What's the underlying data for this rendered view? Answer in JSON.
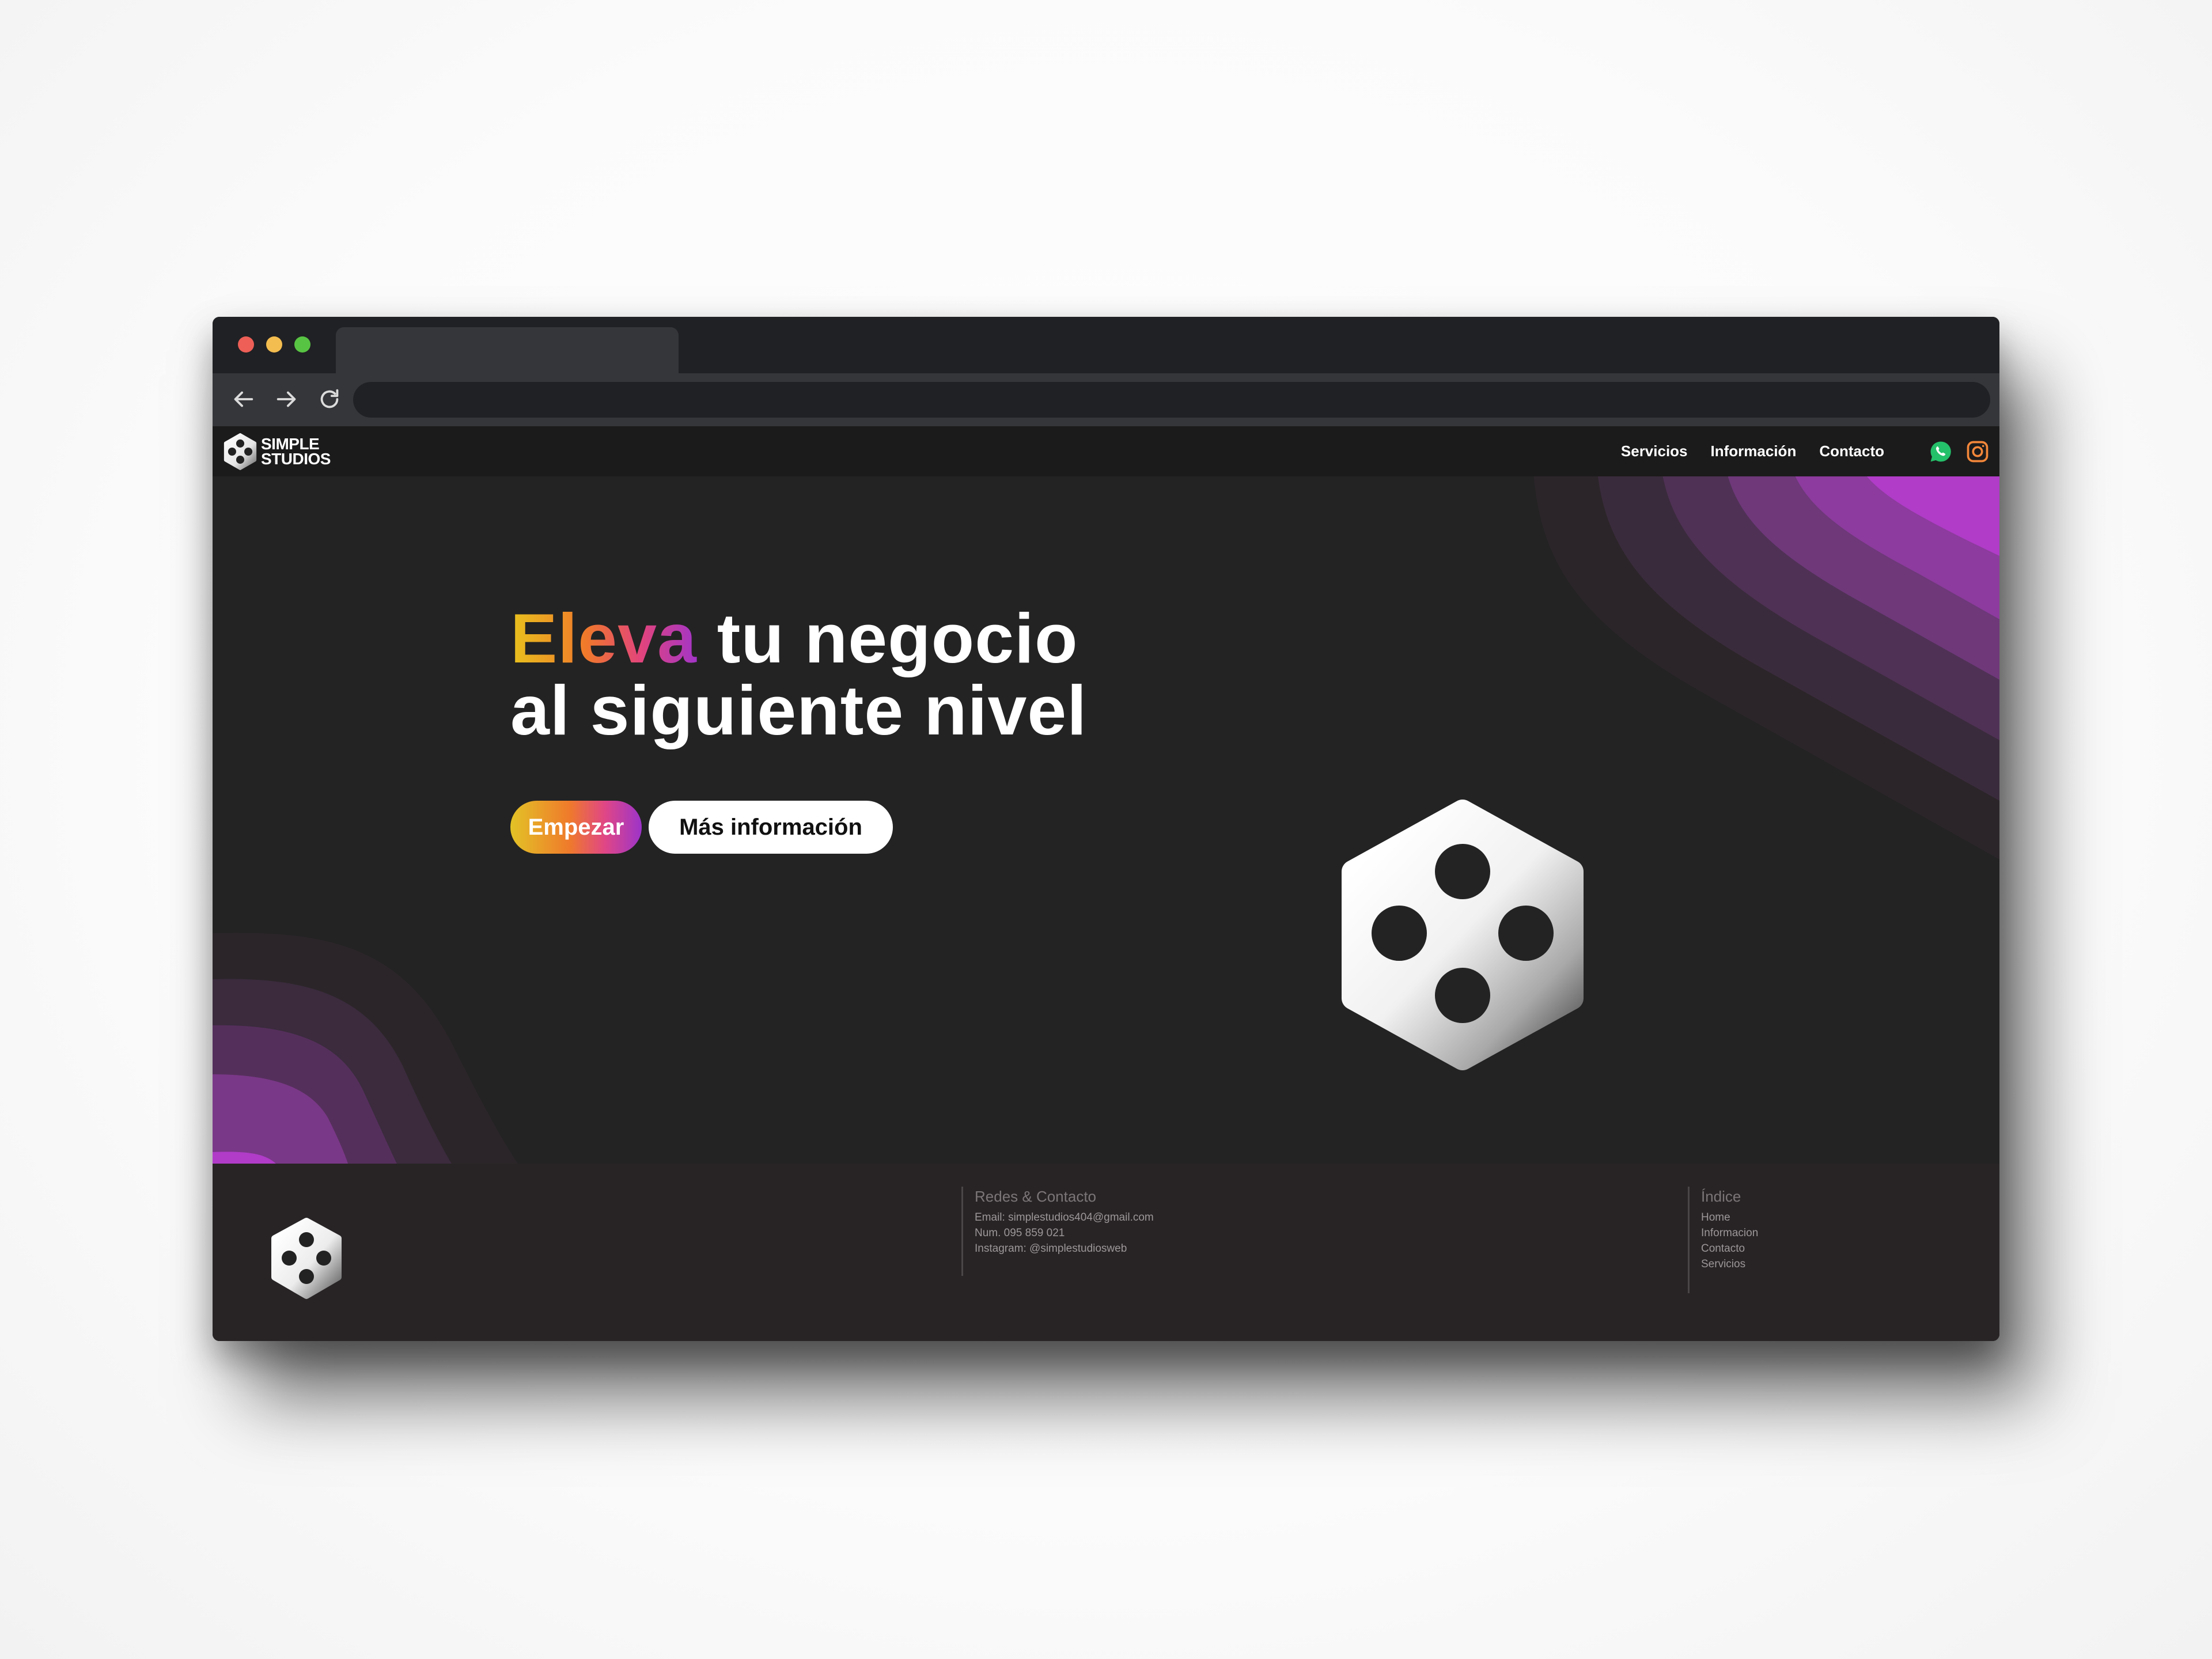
{
  "brand": {
    "line1": "SIMPLE",
    "line2": "STUDIOS",
    "logo_icon": "dice-hexagon-icon"
  },
  "nav": {
    "items": [
      "Servicios",
      "Información",
      "Contacto"
    ]
  },
  "social": {
    "whatsapp_icon": "whatsapp-icon",
    "instagram_icon": "instagram-icon"
  },
  "hero": {
    "highlight": "Eleva",
    "title_rest_line1": "tu negocio",
    "title_line2": "al siguiente nivel",
    "primary_button": "Empezar",
    "secondary_button": "Más información"
  },
  "footer": {
    "contact": {
      "heading": "Redes & Contacto",
      "email": "Email: simplestudios404@gmail.com",
      "phone": "Num. 095 859 021",
      "instagram": "Instagram: @simplestudiosweb"
    },
    "index": {
      "heading": "Índice",
      "links": [
        "Home",
        "Informacion",
        "Contacto",
        "Servicios"
      ]
    }
  },
  "colors": {
    "accent_gradient": [
      "#e8c21d",
      "#f07a2a",
      "#e2447c",
      "#a235c8"
    ],
    "wave_purple": "#b93bd6",
    "whatsapp_green": "#25c06a",
    "instagram_orange": "#f2873a"
  }
}
